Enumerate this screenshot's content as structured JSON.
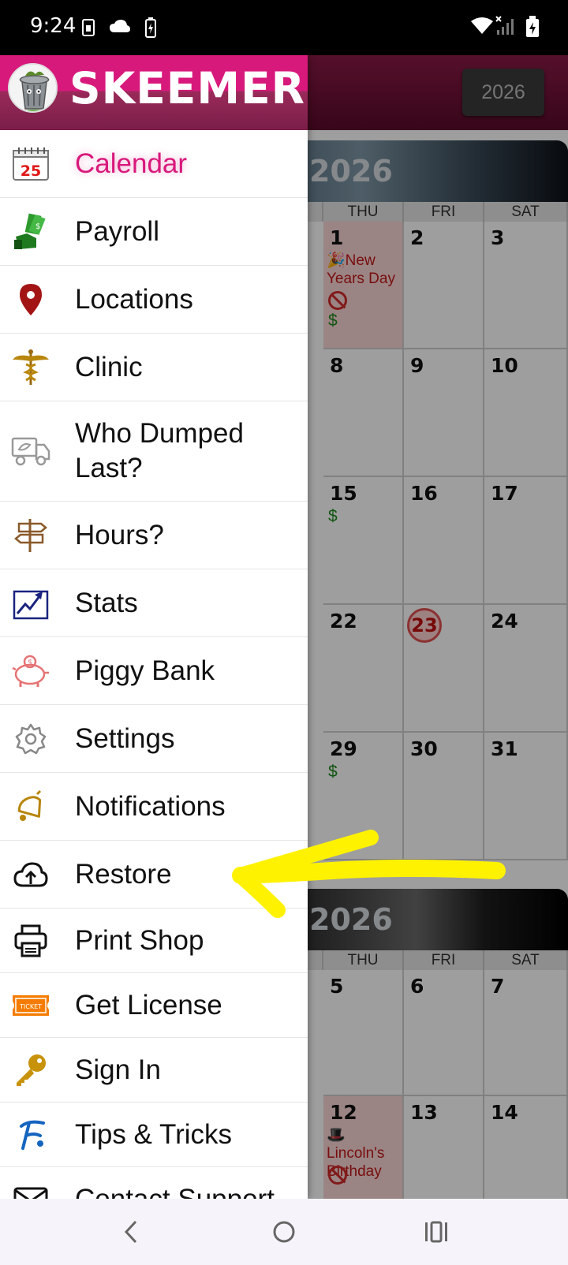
{
  "status_bar": {
    "time": "9:24",
    "left_icons": [
      "sim-card-icon",
      "cloud-icon",
      "battery-charging-small-icon"
    ],
    "right_icons": [
      "wifi-icon",
      "cell-signal-no-service-icon",
      "battery-icon"
    ]
  },
  "background": {
    "year_button": "2026",
    "month_sections": [
      {
        "year": "2026",
        "days_of_week": [
          "THU",
          "FRI",
          "SAT"
        ],
        "rows": [
          [
            {
              "day": "1",
              "holiday": "🎉New Years Day",
              "no_icon": true,
              "pay": "$"
            },
            {
              "day": "2"
            },
            {
              "day": "3"
            }
          ],
          [
            {
              "day": "8"
            },
            {
              "day": "9"
            },
            {
              "day": "10"
            }
          ],
          [
            {
              "day": "15",
              "pay": "$"
            },
            {
              "day": "16"
            },
            {
              "day": "17"
            }
          ],
          [
            {
              "day": "22"
            },
            {
              "day": "23",
              "today": true
            },
            {
              "day": "24"
            }
          ],
          [
            {
              "day": "29",
              "pay": "$"
            },
            {
              "day": "30"
            },
            {
              "day": "31"
            }
          ]
        ]
      },
      {
        "year": "2026",
        "days_of_week": [
          "THU",
          "FRI",
          "SAT"
        ],
        "rows": [
          [
            {
              "day": "5"
            },
            {
              "day": "6"
            },
            {
              "day": "7"
            }
          ],
          [
            {
              "day": "12",
              "holiday": "🎩 Lincoln's Birthday",
              "no_icon": true
            },
            {
              "day": "13"
            },
            {
              "day": "14"
            }
          ]
        ]
      }
    ]
  },
  "drawer": {
    "brand": "SKEEMER",
    "logo_icon": "trash-can-logo-icon",
    "items": [
      {
        "label": "Calendar",
        "icon": "calendar-icon",
        "active": true
      },
      {
        "label": "Payroll",
        "icon": "payroll-money-icon"
      },
      {
        "label": "Locations",
        "icon": "location-pin-icon"
      },
      {
        "label": "Clinic",
        "icon": "caduceus-icon"
      },
      {
        "label": "Who Dumped Last?",
        "icon": "dump-truck-icon"
      },
      {
        "label": "Hours?",
        "icon": "signpost-icon"
      },
      {
        "label": "Stats",
        "icon": "stats-chart-icon"
      },
      {
        "label": "Piggy Bank",
        "icon": "piggy-bank-icon"
      },
      {
        "label": "Settings",
        "icon": "gear-icon"
      },
      {
        "label": "Notifications",
        "icon": "bell-icon"
      },
      {
        "label": "Restore",
        "icon": "cloud-upload-icon"
      },
      {
        "label": "Print Shop",
        "icon": "printer-icon"
      },
      {
        "label": "Get License",
        "icon": "ticket-icon",
        "icon_text": "TICKET"
      },
      {
        "label": "Sign In",
        "icon": "key-icon"
      },
      {
        "label": "Tips & Tricks",
        "icon": "tips-icon"
      },
      {
        "label": "Contact Support",
        "icon": "mail-icon"
      }
    ]
  },
  "annotation": {
    "type": "yellow-arrow",
    "points_to": "Restore"
  },
  "nav_bar": [
    "back-icon",
    "home-icon",
    "recents-icon"
  ],
  "colors": {
    "brand_pink": "#d8197c",
    "header_dark": "#7a1e48",
    "holiday_bg": "#fbd6d6",
    "holiday_text": "#c21818",
    "pay_green": "#1c8a1c",
    "annotation_yellow": "#fff200"
  }
}
